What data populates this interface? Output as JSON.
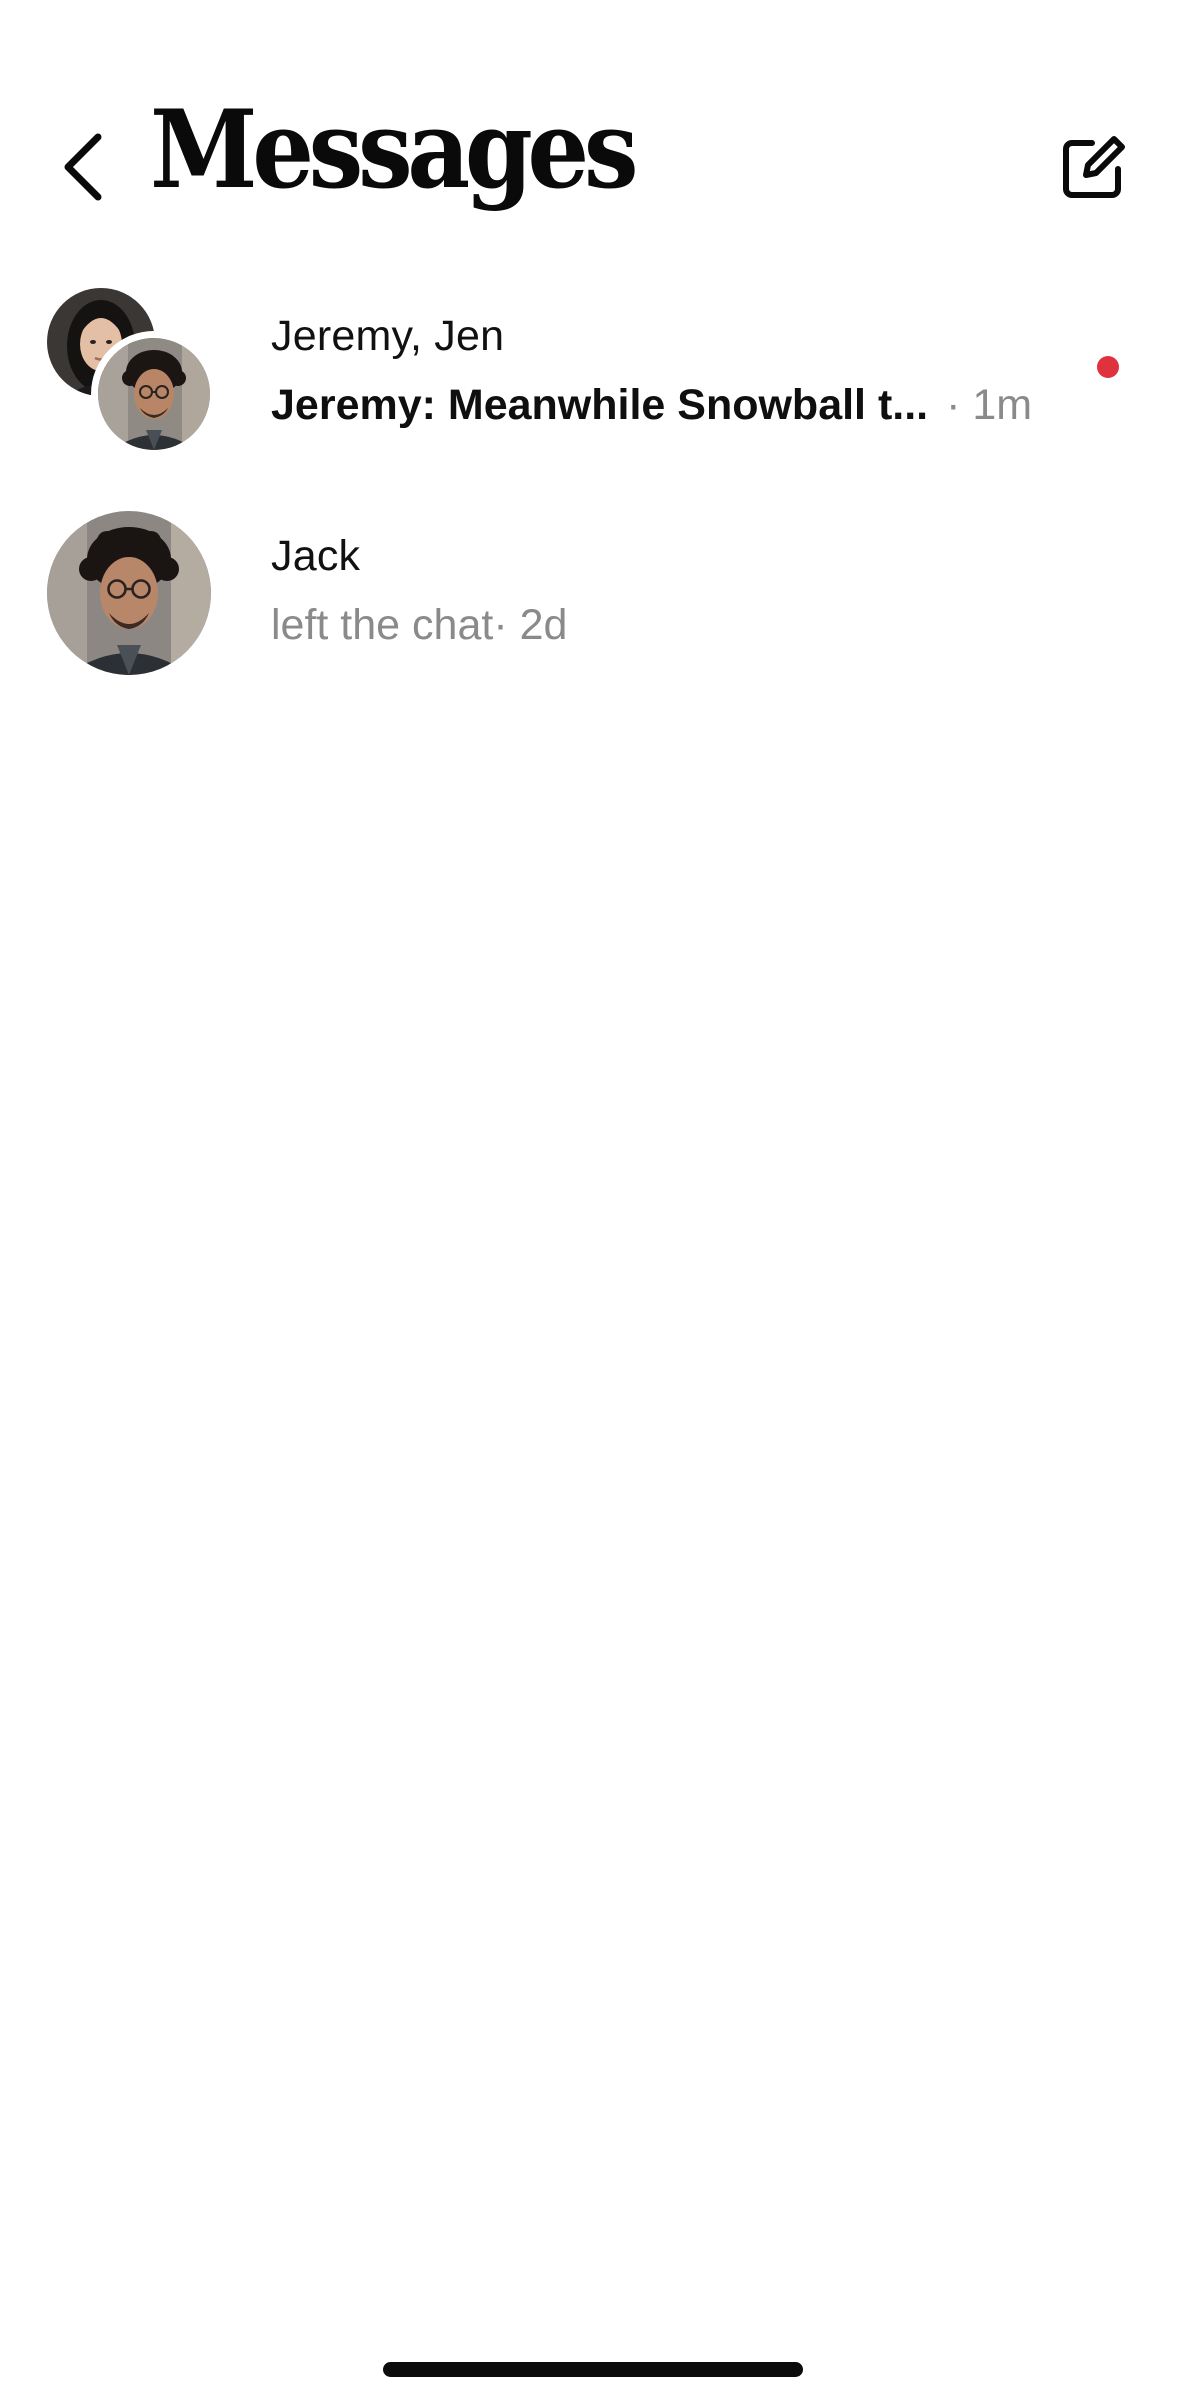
{
  "header": {
    "title": "Messages",
    "back_icon": "chevron-left-icon",
    "compose_icon": "compose-icon"
  },
  "conversations": [
    {
      "name": "Jeremy, Jen",
      "preview": "Jeremy: Meanwhile Snowball t...",
      "time": " · 1m",
      "unread": true,
      "avatars": [
        "woman-portrait",
        "man-glasses-portrait"
      ]
    },
    {
      "name": "Jack",
      "preview": "left the chat",
      "time": " · 2d",
      "unread": false,
      "avatars": [
        "man-glasses-portrait"
      ]
    }
  ],
  "colors": {
    "unread_dot": "#e0313f",
    "secondary_text": "#8a8a8a",
    "primary_text": "#111111",
    "background": "#ffffff"
  }
}
